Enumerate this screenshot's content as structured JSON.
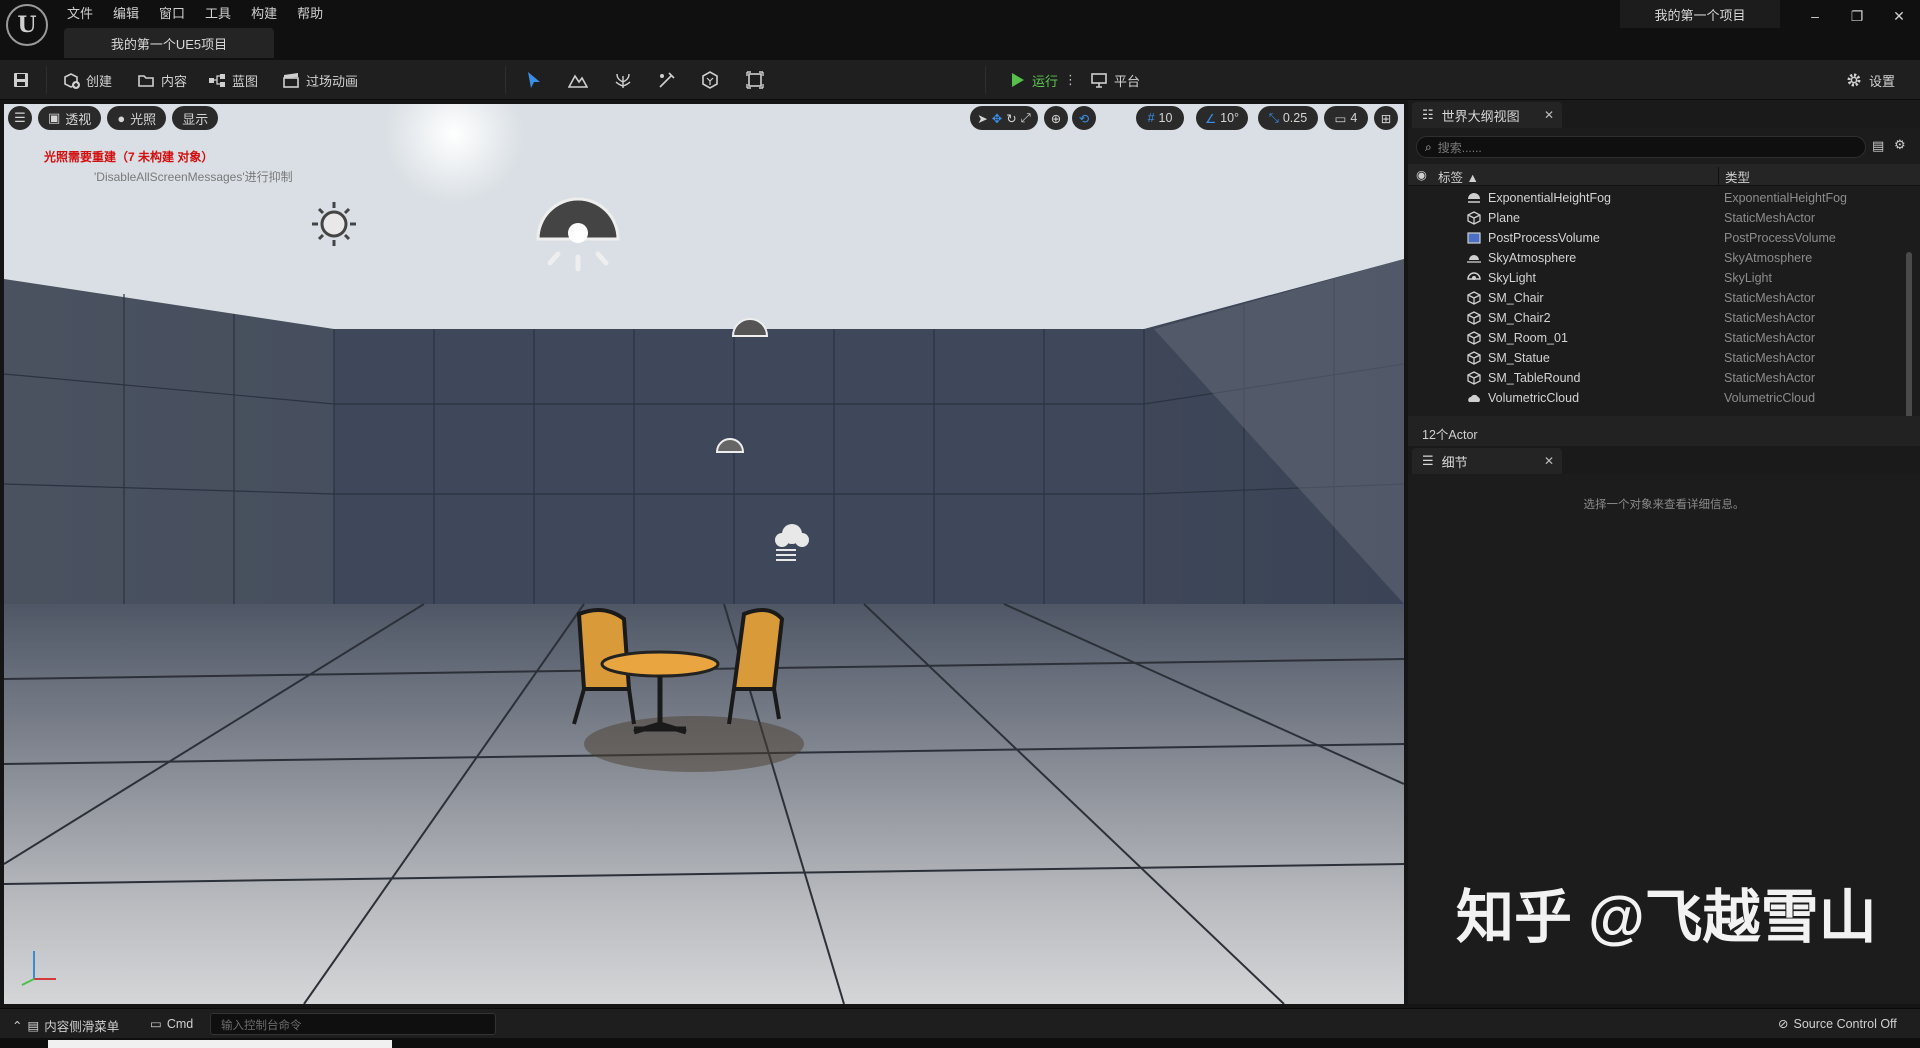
{
  "menu": [
    "文件",
    "编辑",
    "窗口",
    "工具",
    "构建",
    "帮助"
  ],
  "project_tab": "我的第一个UE5项目",
  "project_name": "我的第一个项目",
  "window_controls": {
    "minimize": "–",
    "restore": "❐",
    "close": "✕"
  },
  "toolbar": {
    "create": "创建",
    "content": "内容",
    "blueprint": "蓝图",
    "cinematics": "过场动画",
    "play": "运行",
    "platforms": "平台",
    "settings": "设置"
  },
  "viewport": {
    "perspective": "透视",
    "lit": "光照",
    "show": "显示",
    "grid_snap": "10",
    "rotation_snap": "10°",
    "scale_snap": "0.25",
    "camera_speed": "4",
    "warning_line1": "光照需要重建（7 未构建 对象）",
    "warning_line2": "'DisableAllScreenMessages'进行抑制"
  },
  "outliner": {
    "tab_title": "世界大纲视图",
    "search_placeholder": "搜索......",
    "col_label": "标签",
    "col_type": "类型",
    "rows": [
      {
        "label": "ExponentialHeightFog",
        "type": "ExponentialHeightFog",
        "icon": "fog-icon"
      },
      {
        "label": "Plane",
        "type": "StaticMeshActor",
        "icon": "cube-icon"
      },
      {
        "label": "PostProcessVolume",
        "type": "PostProcessVolume",
        "icon": "volume-icon"
      },
      {
        "label": "SkyAtmosphere",
        "type": "SkyAtmosphere",
        "icon": "sky-icon"
      },
      {
        "label": "SkyLight",
        "type": "SkyLight",
        "icon": "skylight-icon"
      },
      {
        "label": "SM_Chair",
        "type": "StaticMeshActor",
        "icon": "cube-icon"
      },
      {
        "label": "SM_Chair2",
        "type": "StaticMeshActor",
        "icon": "cube-icon"
      },
      {
        "label": "SM_Room_01",
        "type": "StaticMeshActor",
        "icon": "cube-icon"
      },
      {
        "label": "SM_Statue",
        "type": "StaticMeshActor",
        "icon": "cube-icon"
      },
      {
        "label": "SM_TableRound",
        "type": "StaticMeshActor",
        "icon": "cube-icon"
      },
      {
        "label": "VolumetricCloud",
        "type": "VolumetricCloud",
        "icon": "cloud-icon"
      }
    ],
    "actor_count": "12个Actor"
  },
  "details": {
    "tab_title": "细节",
    "empty_message": "选择一个对象来查看详细信息。"
  },
  "watermark": "知乎 @飞越雪山",
  "statusbar": {
    "content_drawer": "内容侧滑菜单",
    "cmd": "Cmd",
    "console_placeholder": "输入控制台命令",
    "source_control": "Source Control Off"
  }
}
